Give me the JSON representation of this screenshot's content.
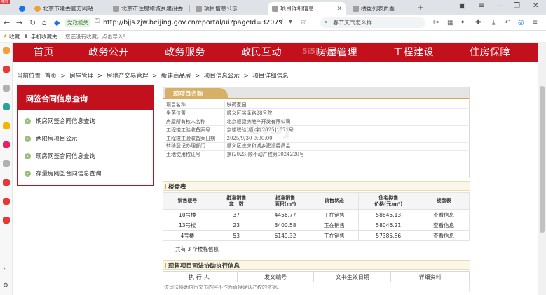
{
  "browser": {
    "corner_badge": "推荐",
    "tabs": [
      {
        "title": "北京市建委官方网站",
        "color": "#4caf50"
      },
      {
        "title": "北京市住房和城乡建设委",
        "color": "#9e9e9e"
      },
      {
        "title": "项目信息公示",
        "color": "#9e9e9e"
      },
      {
        "title": "项目详细信息",
        "color": "#9e9e9e",
        "active": true
      },
      {
        "title": "楼盘列表页面",
        "color": "#9e9e9e"
      }
    ],
    "site_badge": "党政机关",
    "url": "http://bjjs.zjw.beijing.gov.cn/eportal/ui?pageId=32079",
    "search_placeholder": "春节天气怎么样",
    "favbar": {
      "label": "收藏",
      "mobile": "手机收藏夹",
      "hint": "您还没有收藏，点击导入!"
    }
  },
  "site_nav": {
    "items": [
      "首页",
      "政务公开",
      "政务服务",
      "政民互动",
      "房屋管理",
      "工程建设",
      "住房保障"
    ],
    "watermark": "5i5j.com"
  },
  "breadcrumb": {
    "prefix": "当前位置",
    "items": [
      "首页",
      "房屋管理",
      "房地产交易管理",
      "新建商品房",
      "项目信息公示",
      "项目详细信息"
    ],
    "separator": ">"
  },
  "left_menu": {
    "title": "网签合同信息查询",
    "items": [
      "期房网签合同信息查询",
      "两限房项目公示",
      "现房网签合同信息查询",
      "存量房网签合同信息查询"
    ]
  },
  "project_info": {
    "tab_label": "现项目名称",
    "watermark": "5i5j",
    "rows": [
      {
        "key": "项目名称",
        "value": "映荷家园"
      },
      {
        "key": "坐落位置",
        "value": "顺义区裕泽路28号院"
      },
      {
        "key": "房屋所有权人名称",
        "value": "北京顺捷房地产开发有限公司"
      },
      {
        "key": "工程竣工验收备案号",
        "value": "京竣联验(顺)字[2025]1871号"
      },
      {
        "key": "工程竣工验收备案日期",
        "value": "2025/9/30 0:00:00"
      },
      {
        "key": "转移登记办理部门",
        "value": "顺义区住房和城乡建设委员会"
      },
      {
        "key": "土地使用权证号",
        "value": "京(2023)顺不动产权第0024220号"
      }
    ]
  },
  "buildings": {
    "title": "楼盘表",
    "headers": [
      "销售楼号",
      "批准销售\n套　数",
      "批准销售\n面积(m²)",
      "销售状态",
      "住宅拟售\n价格(元/m²)",
      "楼盘表"
    ],
    "rows": [
      {
        "name": "10号楼",
        "units": "37",
        "area": "4456.77",
        "status": "正在销售",
        "price": "58845.13",
        "link": "查看信息"
      },
      {
        "name": "13号楼",
        "units": "23",
        "area": "3400.58",
        "status": "正在销售",
        "price": "58046.21",
        "link": "查看信息"
      },
      {
        "name": "4号楼",
        "units": "53",
        "area": "6149.32",
        "status": "正在销售",
        "price": "57385.86",
        "link": "查看信息"
      }
    ],
    "total": "共有 3 个楼栋信息"
  },
  "court": {
    "title": "现售项目司法协助执行信息",
    "headers": [
      "执行人",
      "发文编号",
      "文书生效日期",
      "详细资料"
    ],
    "note": "该司法协助执行文书内容不作为直接确认产权的依据。"
  }
}
